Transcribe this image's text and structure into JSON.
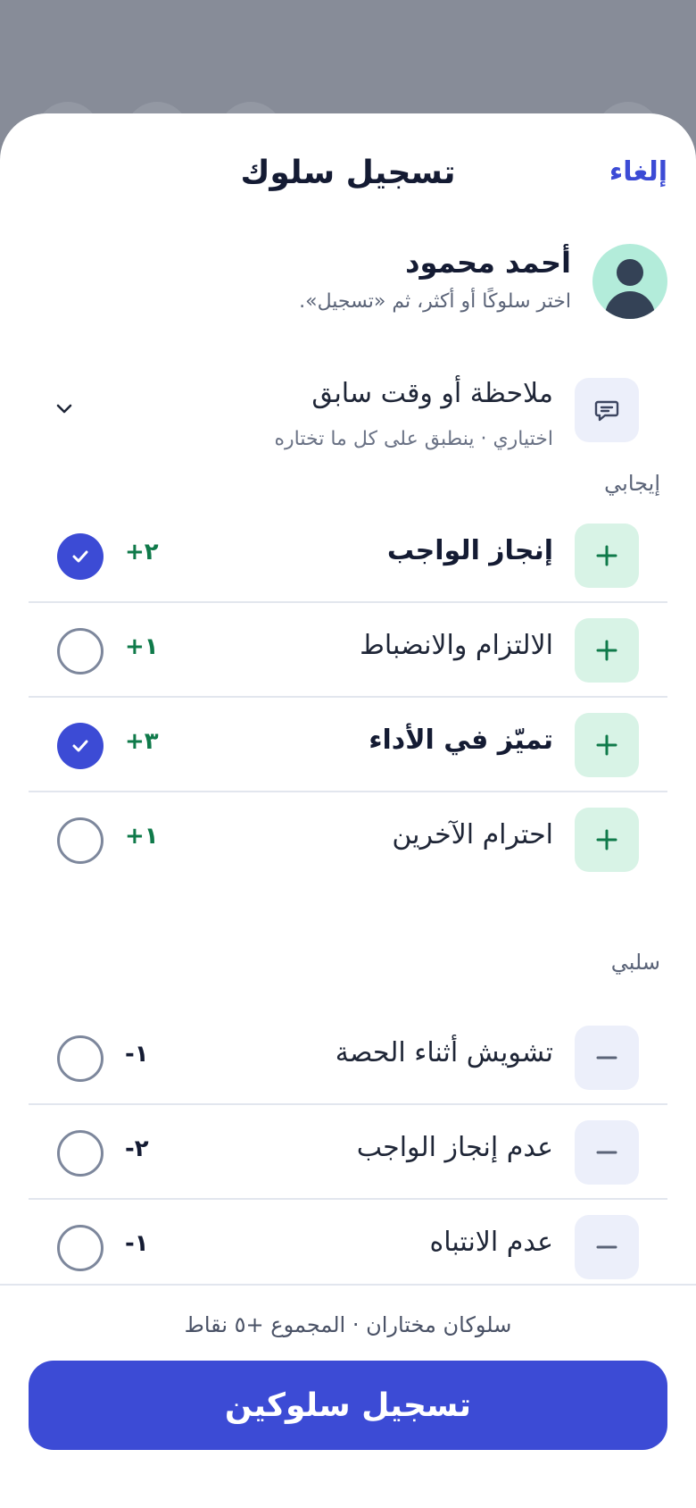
{
  "header": {
    "title": "تسجيل سلوك",
    "cancel_label": "إلغاء"
  },
  "student": {
    "name": "أحمد محمود",
    "hint": "اختر سلوكًا أو أكثر، ثم «تسجيل»."
  },
  "note": {
    "title": "ملاحظة أو وقت سابق",
    "subtitle": "اختياري · ينطبق على كل ما تختاره"
  },
  "sections": {
    "positive_label": "إيجابي",
    "negative_label": "سلبي"
  },
  "positive": [
    {
      "label": "إنجاز الواجب",
      "points": "+٢",
      "selected": true
    },
    {
      "label": "الالتزام والانضباط",
      "points": "+١",
      "selected": false
    },
    {
      "label": "تميّز في الأداء",
      "points": "+٣",
      "selected": true
    },
    {
      "label": "احترام الآخرين",
      "points": "+١",
      "selected": false
    }
  ],
  "negative": [
    {
      "label": "تشويش أثناء الحصة",
      "points": "-١",
      "selected": false
    },
    {
      "label": "عدم إنجاز الواجب",
      "points": "-٢",
      "selected": false
    },
    {
      "label": "عدم الانتباه",
      "points": "-١",
      "selected": false
    }
  ],
  "footer": {
    "summary": "سلوكان مختاران · المجموع +٥ نقاط",
    "submit_label": "تسجيل سلوكين"
  },
  "colors": {
    "accent": "#3c4bd5",
    "positive": "#0f7a4a",
    "text": "#141b33"
  },
  "icons": {
    "note": "chat-bubble-icon",
    "expand": "chevron-down-icon",
    "add": "plus-icon",
    "remove": "minus-icon",
    "check": "checkmark-icon"
  }
}
